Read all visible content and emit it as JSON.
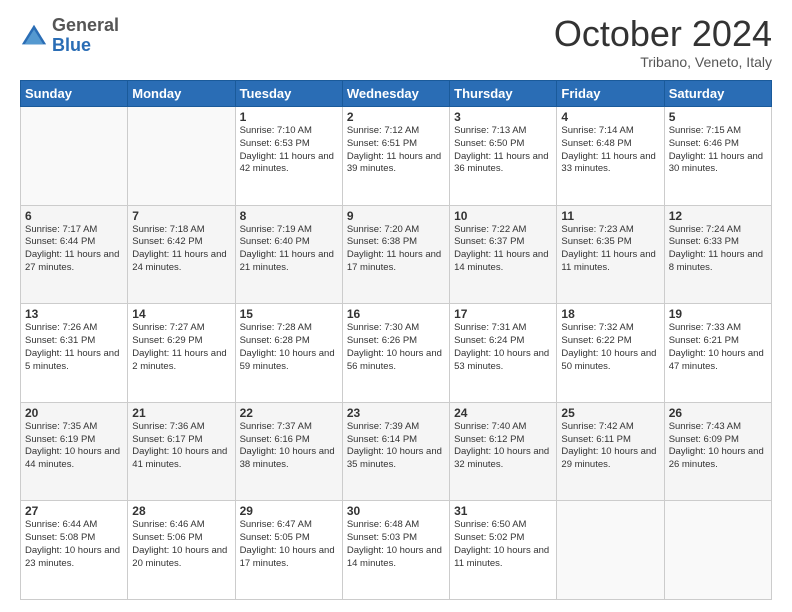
{
  "header": {
    "logo": {
      "general": "General",
      "blue": "Blue"
    },
    "title": "October 2024",
    "location": "Tribano, Veneto, Italy"
  },
  "columns": [
    "Sunday",
    "Monday",
    "Tuesday",
    "Wednesday",
    "Thursday",
    "Friday",
    "Saturday"
  ],
  "weeks": [
    [
      {
        "day": "",
        "info": ""
      },
      {
        "day": "",
        "info": ""
      },
      {
        "day": "1",
        "info": "Sunrise: 7:10 AM\nSunset: 6:53 PM\nDaylight: 11 hours and 42 minutes."
      },
      {
        "day": "2",
        "info": "Sunrise: 7:12 AM\nSunset: 6:51 PM\nDaylight: 11 hours and 39 minutes."
      },
      {
        "day": "3",
        "info": "Sunrise: 7:13 AM\nSunset: 6:50 PM\nDaylight: 11 hours and 36 minutes."
      },
      {
        "day": "4",
        "info": "Sunrise: 7:14 AM\nSunset: 6:48 PM\nDaylight: 11 hours and 33 minutes."
      },
      {
        "day": "5",
        "info": "Sunrise: 7:15 AM\nSunset: 6:46 PM\nDaylight: 11 hours and 30 minutes."
      }
    ],
    [
      {
        "day": "6",
        "info": "Sunrise: 7:17 AM\nSunset: 6:44 PM\nDaylight: 11 hours and 27 minutes."
      },
      {
        "day": "7",
        "info": "Sunrise: 7:18 AM\nSunset: 6:42 PM\nDaylight: 11 hours and 24 minutes."
      },
      {
        "day": "8",
        "info": "Sunrise: 7:19 AM\nSunset: 6:40 PM\nDaylight: 11 hours and 21 minutes."
      },
      {
        "day": "9",
        "info": "Sunrise: 7:20 AM\nSunset: 6:38 PM\nDaylight: 11 hours and 17 minutes."
      },
      {
        "day": "10",
        "info": "Sunrise: 7:22 AM\nSunset: 6:37 PM\nDaylight: 11 hours and 14 minutes."
      },
      {
        "day": "11",
        "info": "Sunrise: 7:23 AM\nSunset: 6:35 PM\nDaylight: 11 hours and 11 minutes."
      },
      {
        "day": "12",
        "info": "Sunrise: 7:24 AM\nSunset: 6:33 PM\nDaylight: 11 hours and 8 minutes."
      }
    ],
    [
      {
        "day": "13",
        "info": "Sunrise: 7:26 AM\nSunset: 6:31 PM\nDaylight: 11 hours and 5 minutes."
      },
      {
        "day": "14",
        "info": "Sunrise: 7:27 AM\nSunset: 6:29 PM\nDaylight: 11 hours and 2 minutes."
      },
      {
        "day": "15",
        "info": "Sunrise: 7:28 AM\nSunset: 6:28 PM\nDaylight: 10 hours and 59 minutes."
      },
      {
        "day": "16",
        "info": "Sunrise: 7:30 AM\nSunset: 6:26 PM\nDaylight: 10 hours and 56 minutes."
      },
      {
        "day": "17",
        "info": "Sunrise: 7:31 AM\nSunset: 6:24 PM\nDaylight: 10 hours and 53 minutes."
      },
      {
        "day": "18",
        "info": "Sunrise: 7:32 AM\nSunset: 6:22 PM\nDaylight: 10 hours and 50 minutes."
      },
      {
        "day": "19",
        "info": "Sunrise: 7:33 AM\nSunset: 6:21 PM\nDaylight: 10 hours and 47 minutes."
      }
    ],
    [
      {
        "day": "20",
        "info": "Sunrise: 7:35 AM\nSunset: 6:19 PM\nDaylight: 10 hours and 44 minutes."
      },
      {
        "day": "21",
        "info": "Sunrise: 7:36 AM\nSunset: 6:17 PM\nDaylight: 10 hours and 41 minutes."
      },
      {
        "day": "22",
        "info": "Sunrise: 7:37 AM\nSunset: 6:16 PM\nDaylight: 10 hours and 38 minutes."
      },
      {
        "day": "23",
        "info": "Sunrise: 7:39 AM\nSunset: 6:14 PM\nDaylight: 10 hours and 35 minutes."
      },
      {
        "day": "24",
        "info": "Sunrise: 7:40 AM\nSunset: 6:12 PM\nDaylight: 10 hours and 32 minutes."
      },
      {
        "day": "25",
        "info": "Sunrise: 7:42 AM\nSunset: 6:11 PM\nDaylight: 10 hours and 29 minutes."
      },
      {
        "day": "26",
        "info": "Sunrise: 7:43 AM\nSunset: 6:09 PM\nDaylight: 10 hours and 26 minutes."
      }
    ],
    [
      {
        "day": "27",
        "info": "Sunrise: 6:44 AM\nSunset: 5:08 PM\nDaylight: 10 hours and 23 minutes."
      },
      {
        "day": "28",
        "info": "Sunrise: 6:46 AM\nSunset: 5:06 PM\nDaylight: 10 hours and 20 minutes."
      },
      {
        "day": "29",
        "info": "Sunrise: 6:47 AM\nSunset: 5:05 PM\nDaylight: 10 hours and 17 minutes."
      },
      {
        "day": "30",
        "info": "Sunrise: 6:48 AM\nSunset: 5:03 PM\nDaylight: 10 hours and 14 minutes."
      },
      {
        "day": "31",
        "info": "Sunrise: 6:50 AM\nSunset: 5:02 PM\nDaylight: 10 hours and 11 minutes."
      },
      {
        "day": "",
        "info": ""
      },
      {
        "day": "",
        "info": ""
      }
    ]
  ]
}
